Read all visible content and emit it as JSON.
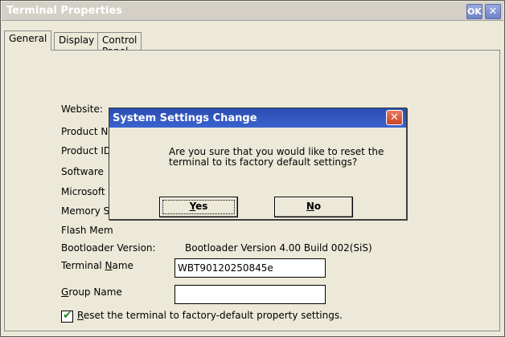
{
  "window": {
    "title": "Terminal Properties",
    "ok_label": "OK",
    "close_glyph": "✕"
  },
  "tabs": [
    {
      "label": "General"
    },
    {
      "label": "Display"
    },
    {
      "label": "Control Panel"
    }
  ],
  "general": {
    "website_label": "Website:",
    "product_name_label": "Product N",
    "product_id_label": "Product ID",
    "software_label": "Software",
    "microsoft_label": "Microsoft",
    "memory_label": "Memory S",
    "flash_label": "Flash Mem",
    "bootloader_label": "Bootloader Version:",
    "bootloader_value": "Bootloader Version 4.00 Build 002(SiS)",
    "terminal_name_label_pre": "Terminal ",
    "terminal_name_label_accel": "N",
    "terminal_name_label_post": "ame",
    "terminal_name_value": "WBT90120250845e",
    "group_name_label_accel": "G",
    "group_name_label_post": "roup  Name",
    "group_name_value": "",
    "reset_checkbox_checked": true,
    "reset_label_accel": "R",
    "reset_label_post": "eset the terminal to factory-default property settings."
  },
  "dialog": {
    "title": "System Settings Change",
    "close_glyph": "✕",
    "message": "Are you sure that you would like to reset the terminal to its factory default settings?",
    "yes_accel": "Y",
    "yes_post": "es",
    "no_accel": "N",
    "no_post": "o"
  },
  "colors": {
    "dialog_title_bar": "#2a4db0",
    "dialog_close": "#c8452a",
    "checkbox_mark": "#2b8a2b"
  }
}
